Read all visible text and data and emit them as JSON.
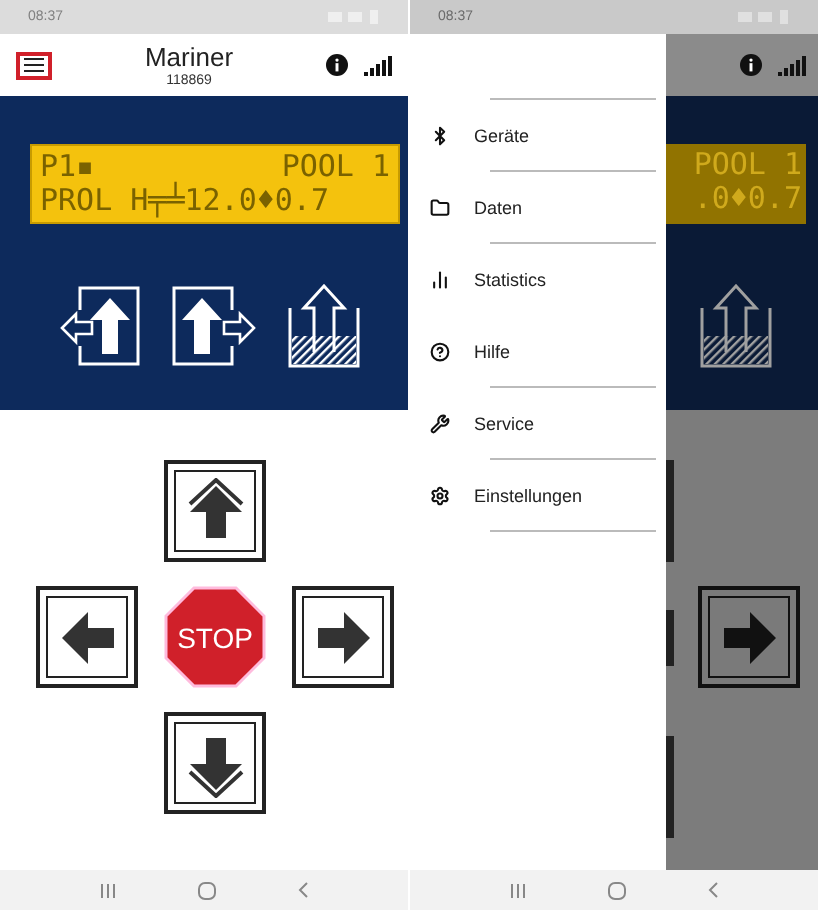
{
  "left_screen": {
    "status_bar": {
      "time": "08:37"
    },
    "header": {
      "title": "Mariner",
      "subtitle": "118869",
      "menu_highlighted": true
    },
    "lcd": {
      "line_1_left": "P1▪",
      "line_1_right": "POOL 1",
      "line_2": "PROL H╤╧12.0♦0.7"
    },
    "pad": {
      "stop_label": "STOP"
    }
  },
  "right_screen": {
    "status_bar": {
      "time": "08:37"
    },
    "drawer": {
      "items": [
        {
          "label": "Geräte",
          "divider": true
        },
        {
          "label": "Daten",
          "divider": true
        },
        {
          "label": "Statistics",
          "divider": false
        },
        {
          "label": "Hilfe",
          "divider": true
        },
        {
          "label": "Service",
          "divider": true
        },
        {
          "label": "Einstellungen",
          "divider": true
        }
      ]
    },
    "lcd": {
      "line_1": "POOL 1",
      "line_2": ".0♦0.7"
    }
  }
}
